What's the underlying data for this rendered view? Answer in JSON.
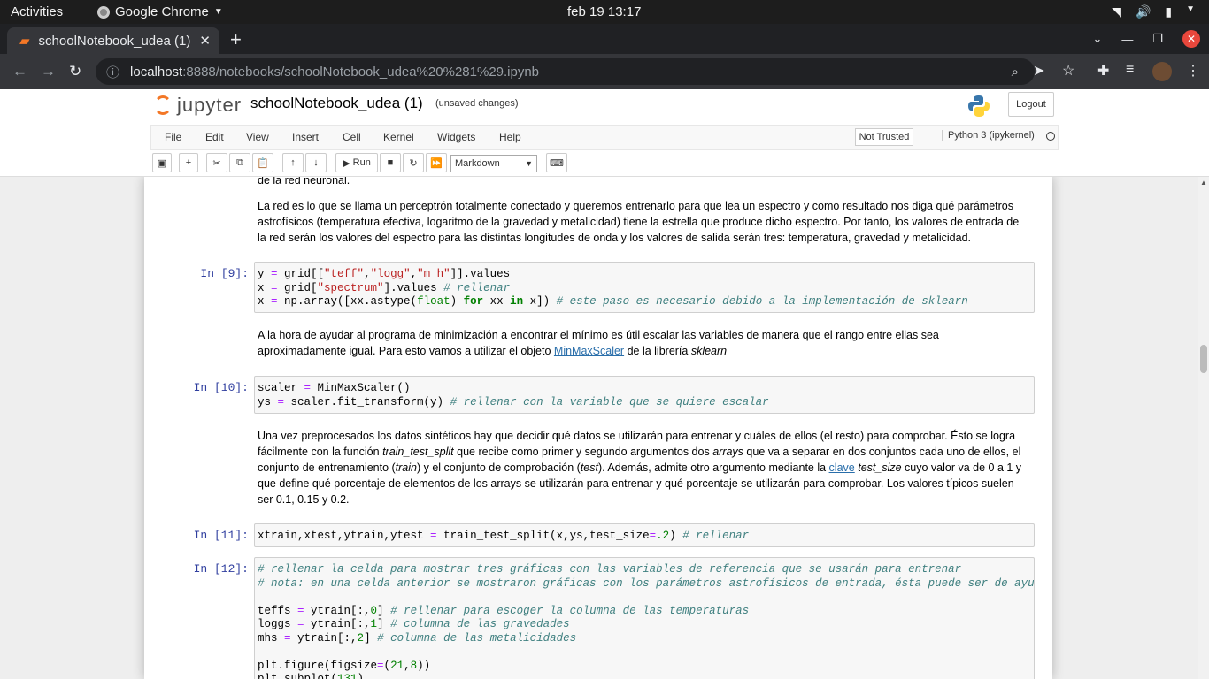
{
  "system_bar": {
    "activities": "Activities",
    "app": "Google Chrome",
    "clock": "feb 19  13:17"
  },
  "browser": {
    "tab_title": "schoolNotebook_udea (1)",
    "url_host": "localhost",
    "url_path": ":8888/notebooks/schoolNotebook_udea%20%281%29.ipynb"
  },
  "jupyter": {
    "logo_text": "jupyter",
    "title": "schoolNotebook_udea (1)",
    "status": "(unsaved changes)",
    "logout": "Logout",
    "menu": [
      "File",
      "Edit",
      "View",
      "Insert",
      "Cell",
      "Kernel",
      "Widgets",
      "Help"
    ],
    "trusted": "Not Trusted",
    "kernel": "Python 3 (ipykernel)",
    "run_label": "Run",
    "cell_type": "Markdown"
  },
  "cells": {
    "md0": "de la red neuronal.",
    "md1": "La red es lo que se llama un perceptrón totalmente conectado y queremos entrenarlo para que lea un espectro y como resultado nos diga qué parámetros astrofísicos (temperatura efectiva, logaritmo de la gravedad y metalicidad) tiene la estrella que produce dicho espectro. Por tanto, los valores de entrada de la red serán los valores del espectro para las distintas longitudes de onda y los valores de salida serán tres: temperatura, gravedad y metalicidad.",
    "p9": "In [9]:",
    "md2_a": "A la hora de ayudar al programa de minimización a encontrar el mínimo es útil escalar las variables de manera que el rango entre ellas sea aproximadamente igual. Para esto vamos a utilizar el objeto ",
    "md2_link": "MinMaxScaler",
    "md2_b": " de la librería ",
    "md2_c": "sklearn",
    "p10": "In [10]:",
    "md3_a": "Una vez preprocesados los datos sintéticos hay que decidir qué datos se utilizarán para entrenar y cuáles de ellos (el resto) para comprobar. Ésto se logra fácilmente con la función ",
    "md3_b": "train_test_split",
    "md3_c": " que recibe como primer y segundo argumentos dos ",
    "md3_d": "arrays",
    "md3_e": " que va a separar en dos conjuntos cada uno de ellos, el conjunto de entrenamiento (",
    "md3_f": "train",
    "md3_g": ") y el conjunto de comprobación (",
    "md3_h": "test",
    "md3_i": "). Además, admite otro argumento mediante la ",
    "md3_link": "clave",
    "md3_j": " ",
    "md3_k": "test_size",
    "md3_l": " cuyo valor va de 0 a 1 y que define qué porcentaje de elementos de los arrays se utilizarán para entrenar y qué porcentaje se utilizarán para comprobar. Los valores típicos suelen ser 0.1, 0.15 y 0.2.",
    "p11": "In [11]:",
    "p12": "In [12]:"
  },
  "colors": {
    "jupyter_orange": "#f37726",
    "prompt_blue": "#303f9f",
    "link": "#296eaa"
  }
}
